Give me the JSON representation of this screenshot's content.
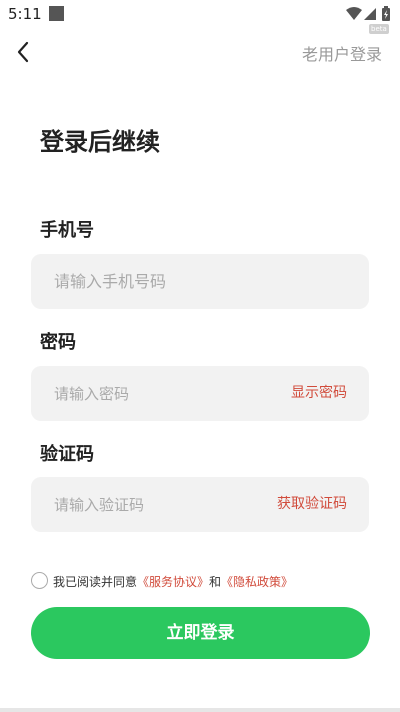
{
  "status": {
    "time": "5:11"
  },
  "header": {
    "back_icon": "chevron-left-icon",
    "old_user_link": "老用户登录",
    "beta_tag": "beta"
  },
  "title": "登录后继续",
  "phone": {
    "label": "手机号",
    "placeholder": "请输入手机号码"
  },
  "password": {
    "label": "密码",
    "placeholder": "请输入密码",
    "action": "显示密码"
  },
  "code": {
    "label": "验证码",
    "placeholder": "请输入验证码",
    "action": "获取验证码"
  },
  "agreement": {
    "prefix": "我已阅读并同意",
    "service": "《服务协议》",
    "conj": "和",
    "privacy": "《隐私政策》",
    "checked": false
  },
  "submit": {
    "label": "立即登录"
  },
  "colors": {
    "primary": "#2bc85f",
    "link": "#d14b3b",
    "field_bg": "#f2f2f2"
  }
}
